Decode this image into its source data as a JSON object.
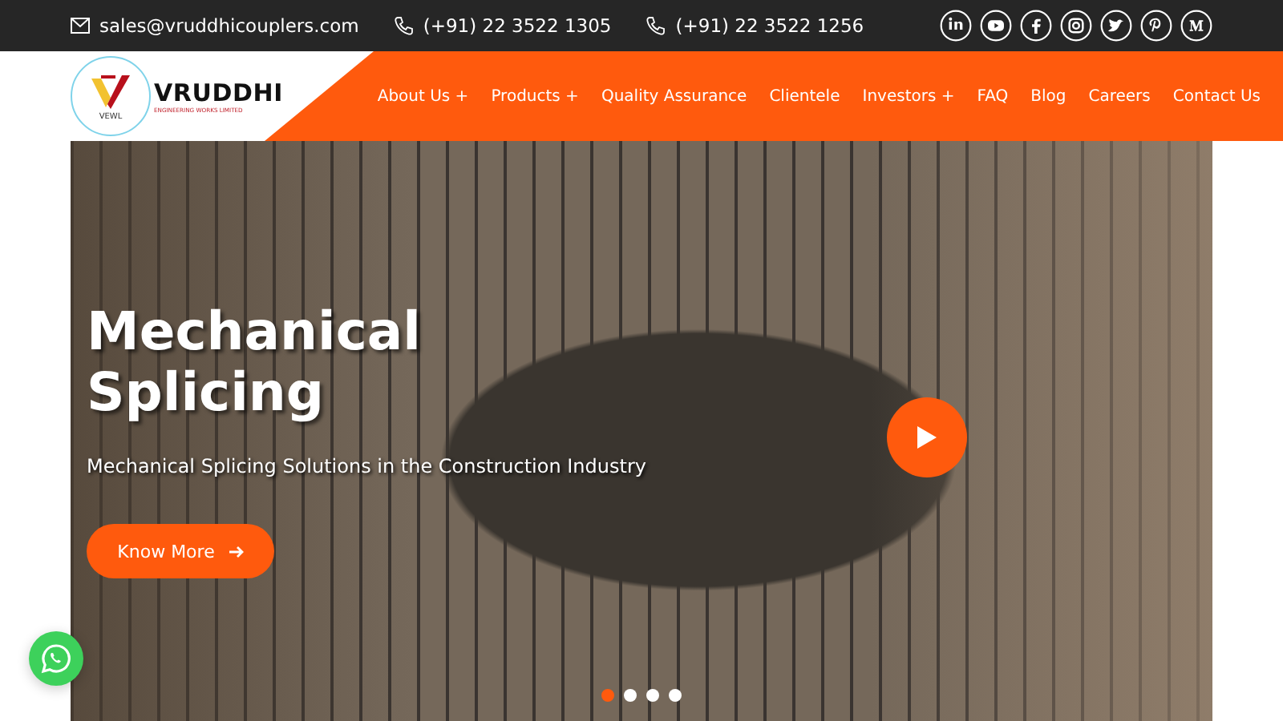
{
  "top_bar": {
    "email": "sales@vruddhicouplers.com",
    "phones": [
      "(+91) 22 3522 1305",
      "(+91) 22 3522 1256"
    ]
  },
  "logo": {
    "mark": "VEWL",
    "name": "VRUDDHI",
    "tagline": "ENGINEERING WORKS LIMITED"
  },
  "nav": [
    {
      "label": "About Us",
      "has_submenu": true
    },
    {
      "label": "Products",
      "has_submenu": true
    },
    {
      "label": "Quality Assurance",
      "has_submenu": false
    },
    {
      "label": "Clientele",
      "has_submenu": false
    },
    {
      "label": "Investors",
      "has_submenu": true
    },
    {
      "label": "FAQ",
      "has_submenu": false
    },
    {
      "label": "Blog",
      "has_submenu": false
    },
    {
      "label": "Careers",
      "has_submenu": false
    },
    {
      "label": "Contact Us",
      "has_submenu": false
    }
  ],
  "submenu_mark": "+",
  "hero": {
    "title": "Mechanical Splicing",
    "subtitle": "Mechanical Splicing Solutions in the Construction Industry",
    "button": "Know More"
  },
  "slides": [
    {
      "selected": true
    },
    {
      "selected": false
    },
    {
      "selected": false
    },
    {
      "selected": false
    }
  ]
}
